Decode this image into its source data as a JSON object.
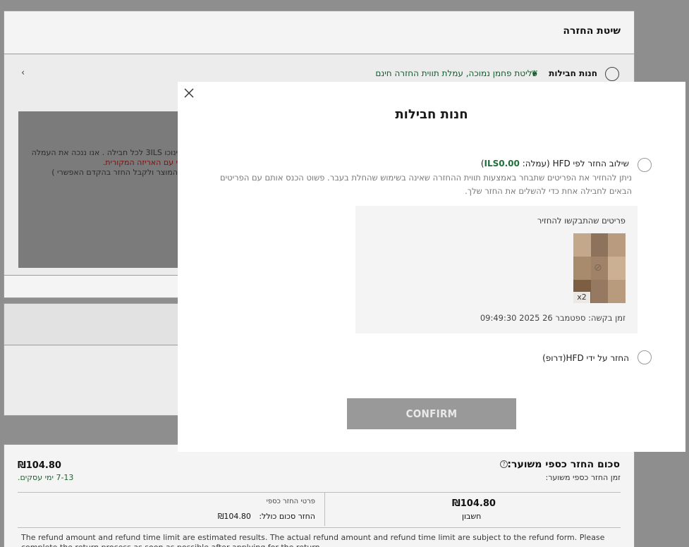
{
  "background": {
    "section_title": "שיטת החזרה",
    "option_label": "חנות חבילות",
    "option_note": "פליטת פחמן נמוכה, עמלת תווית החזרה חינם",
    "info_line_1": "ינוכו 3ILS לכל חבילה . אנו ננכה את העמלה",
    "info_line_2": "י עם האריזה המקורית.",
    "info_line_3": "המוצר ולקבל החזר בהקדם האפשרי )",
    "refund_title": "סכום החזר כספי משוער:",
    "refund_subtitle": "זמן החזר כספי משוער:",
    "refund_amount": "₪104.80",
    "refund_days": "7-13 ימי עסקים.",
    "account_amount": "₪104.80",
    "account_label": "חשבון",
    "details_heading": "פרטי החזר כספי",
    "details_total_label": "החזר סכום כולל:",
    "details_total_value": "₪104.80",
    "disclaimer": "The refund amount and refund time limit are estimated results. The actual refund amount and refund time limit are subject to the refund form. Please complete the return process as soon as possible after applying for the return."
  },
  "modal": {
    "title": "חנות חבילות",
    "close_icon": "close-icon",
    "option1": {
      "label_prefix": "שילוב החזר לפי HFD (עמלה: ",
      "fee": "ILS0.00",
      "label_suffix": ")",
      "description": "ניתן להחזיר את הפריטים שתבחר באמצעות תווית ההחזרה שאינה בשימוש שהחלת בעבר. פשוט הכנס אותם עם הפריטים הבאים לחבילה אחת כדי להשלים את החזר שלך."
    },
    "items": {
      "title": "פריטים שהתבקשו להחזיר",
      "quantity": "x2",
      "request_time": "זמן בקשה: ספטמבר 26 2025 09:49:30"
    },
    "option2": {
      "label": "החזר על ידי HFD(דרופ)"
    },
    "confirm_label": "CONFIRM"
  },
  "colors": {
    "overlay_bg": "#8e8e8e",
    "accent_green": "#1f6f3c",
    "confirm_disabled": "#999999"
  }
}
